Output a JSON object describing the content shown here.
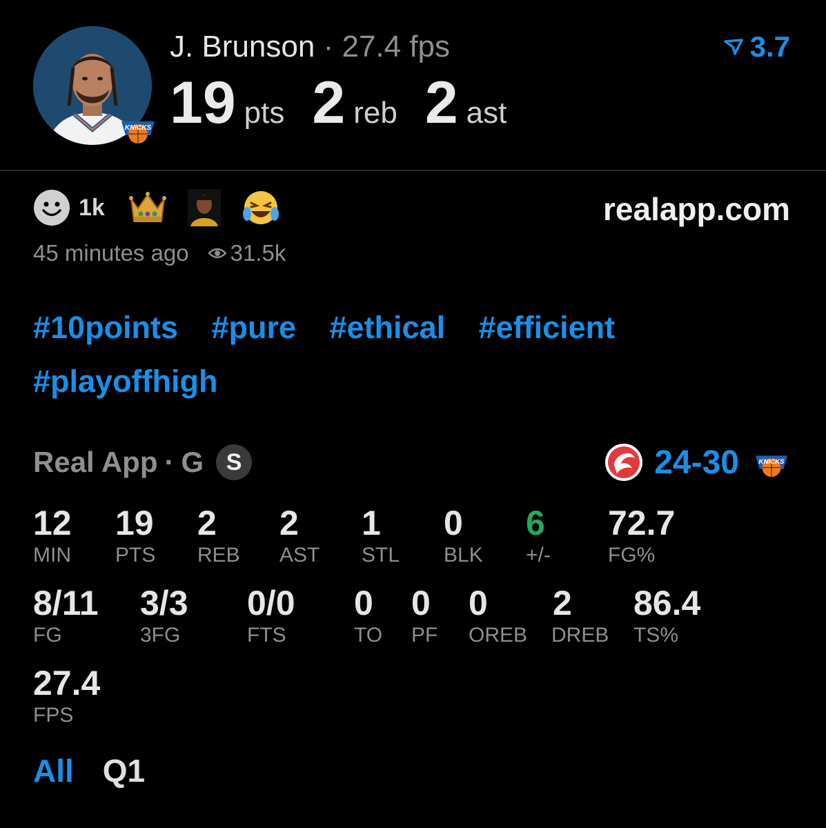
{
  "header": {
    "player_name": "J. Brunson",
    "separator": "·",
    "fps": "27.4 fps",
    "stats": [
      {
        "value": "19",
        "unit": "pts"
      },
      {
        "value": "2",
        "unit": "reb"
      },
      {
        "value": "2",
        "unit": "ast"
      }
    ],
    "rating": "3.7"
  },
  "reactions": {
    "count": "1k",
    "emojis": [
      "crown-icon",
      "player-face-icon",
      "laughing-emoji-icon"
    ],
    "site": "realapp.com"
  },
  "meta": {
    "time_ago": "45 minutes ago",
    "views": "31.5k"
  },
  "hashtags": [
    "#10points",
    "#pure",
    "#ethical",
    "#efficient",
    "#playoffhigh"
  ],
  "game": {
    "source": "Real App",
    "separator": "·",
    "position": "G",
    "badge": "S",
    "score_left": "24",
    "score_sep": "-",
    "score_right": "30"
  },
  "stat_grid": [
    {
      "value": "12",
      "label": "MIN"
    },
    {
      "value": "19",
      "label": "PTS"
    },
    {
      "value": "2",
      "label": "REB"
    },
    {
      "value": "2",
      "label": "AST"
    },
    {
      "value": "1",
      "label": "STL"
    },
    {
      "value": "0",
      "label": "BLK"
    },
    {
      "value": "6",
      "label": "+/-"
    },
    {
      "value": "72.7",
      "label": "FG%"
    },
    {
      "value": "8/11",
      "label": "FG"
    },
    {
      "value": "3/3",
      "label": "3FG"
    },
    {
      "value": "0/0",
      "label": "FTS"
    },
    {
      "value": "0",
      "label": "TO"
    },
    {
      "value": "0",
      "label": "PF"
    },
    {
      "value": "0",
      "label": "OREB"
    },
    {
      "value": "2",
      "label": "DREB"
    },
    {
      "value": "86.4",
      "label": "TS%"
    },
    {
      "value": "27.4",
      "label": "FPS"
    }
  ],
  "tabs": [
    {
      "label": "All",
      "active": true
    },
    {
      "label": "Q1",
      "active": false
    }
  ],
  "colors": {
    "accent": "#1a8fe8",
    "positive": "#22a95a",
    "muted": "#8e8e93",
    "background": "#000000"
  }
}
